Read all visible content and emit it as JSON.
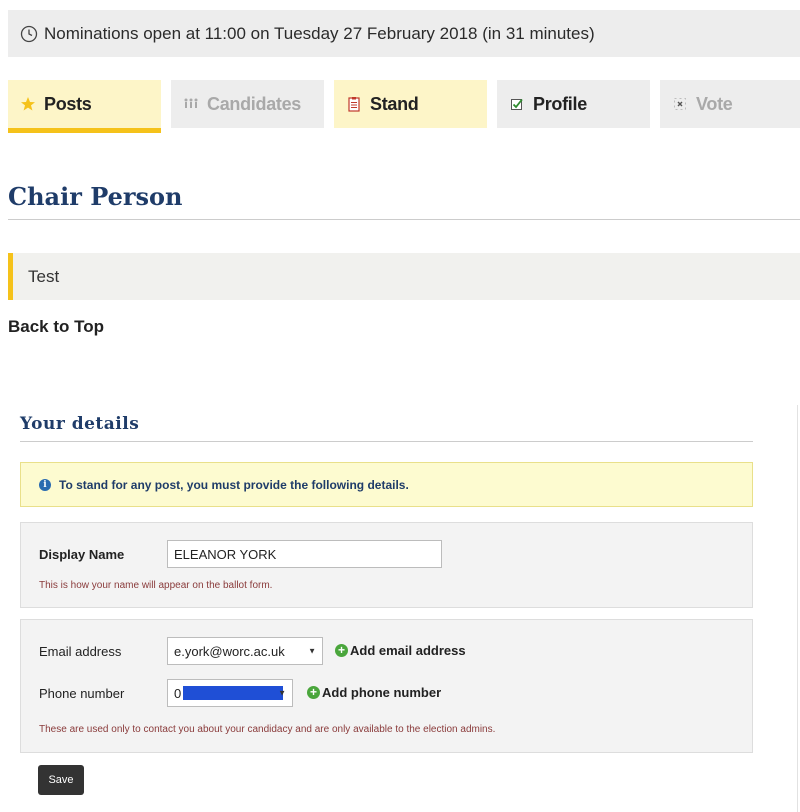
{
  "notice": {
    "text": "Nominations open at 11:00 on Tuesday 27 February 2018 (in 31 minutes)",
    "icon": "clock-icon"
  },
  "tabs": [
    {
      "label": "Posts",
      "icon": "star-icon",
      "state": "active"
    },
    {
      "label": "Candidates",
      "icon": "people-icon",
      "state": "disabled"
    },
    {
      "label": "Stand",
      "icon": "clipboard-icon",
      "state": "highlighted"
    },
    {
      "label": "Profile",
      "icon": "checkbox-icon",
      "state": "normal"
    },
    {
      "label": "Vote",
      "icon": "ballot-icon",
      "state": "disabled"
    }
  ],
  "post": {
    "title": "Chair Person",
    "description": "Test",
    "back_to_top": "Back to Top"
  },
  "details": {
    "title": "Your details",
    "info": "To stand for any post, you must provide the following details.",
    "display_name_label": "Display Name",
    "display_name_value": "ELEANOR YORK",
    "display_name_hint": "This is how your name will appear on the ballot form.",
    "email_label": "Email address",
    "email_value": "e.york@worc.ac.uk",
    "add_email": "Add email address",
    "phone_label": "Phone number",
    "phone_value": "0",
    "add_phone": "Add phone number",
    "contact_hint": "These are used only to contact you about your candidacy and are only available to the election admins.",
    "save": "Save"
  },
  "colors": {
    "accent": "#f5c21a",
    "heading": "#1f3c69",
    "highlight_tab": "#fdf5c8",
    "tab_bg": "#ededed",
    "add_icon": "#4aa63c"
  }
}
